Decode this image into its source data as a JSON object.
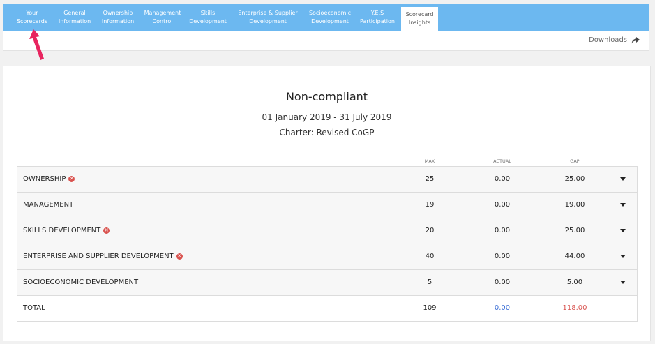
{
  "nav": {
    "tabs": [
      {
        "label": "Your\nScorecards",
        "active": false
      },
      {
        "label": "General\nInformation",
        "active": false
      },
      {
        "label": "Ownership\nInformation",
        "active": false
      },
      {
        "label": "Management\nControl",
        "active": false
      },
      {
        "label": "Skills\nDevelopment",
        "active": false
      },
      {
        "label": "Enterprise & Supplier\nDevelopment",
        "active": false
      },
      {
        "label": "Socioeconomic\nDevelopment",
        "active": false
      },
      {
        "label": "Y.E.S\nParticipation",
        "active": false
      },
      {
        "label": "Scorecard\nInsights",
        "active": true
      }
    ],
    "color": "#6cb8f0"
  },
  "toolbar": {
    "downloads_label": "Downloads",
    "downloads_icon": "share-arrow-icon"
  },
  "summary": {
    "status": "Non-compliant",
    "period": "01 January 2019 - 31 July 2019",
    "charter": "Charter: Revised CoGP"
  },
  "table": {
    "headers": {
      "max": "MAX",
      "actual": "ACTUAL",
      "gap": "GAP"
    },
    "rows": [
      {
        "label": "OWNERSHIP",
        "error": true,
        "max": "25",
        "actual": "0.00",
        "gap": "25.00"
      },
      {
        "label": "MANAGEMENT",
        "error": false,
        "max": "19",
        "actual": "0.00",
        "gap": "19.00"
      },
      {
        "label": "SKILLS DEVELOPMENT",
        "error": true,
        "max": "20",
        "actual": "0.00",
        "gap": "25.00"
      },
      {
        "label": "ENTERPRISE AND SUPPLIER DEVELOPMENT",
        "error": true,
        "max": "40",
        "actual": "0.00",
        "gap": "44.00"
      },
      {
        "label": "SOCIOECONOMIC DEVELOPMENT",
        "error": false,
        "max": "5",
        "actual": "0.00",
        "gap": "5.00"
      }
    ],
    "total": {
      "label": "TOTAL",
      "max": "109",
      "actual": "0.00",
      "gap": "118.00"
    }
  },
  "colors": {
    "error": "#d9534f",
    "actual_total": "#3b6fd6",
    "gap_total": "#d9534f",
    "annotation_arrow": "#e8245f"
  }
}
